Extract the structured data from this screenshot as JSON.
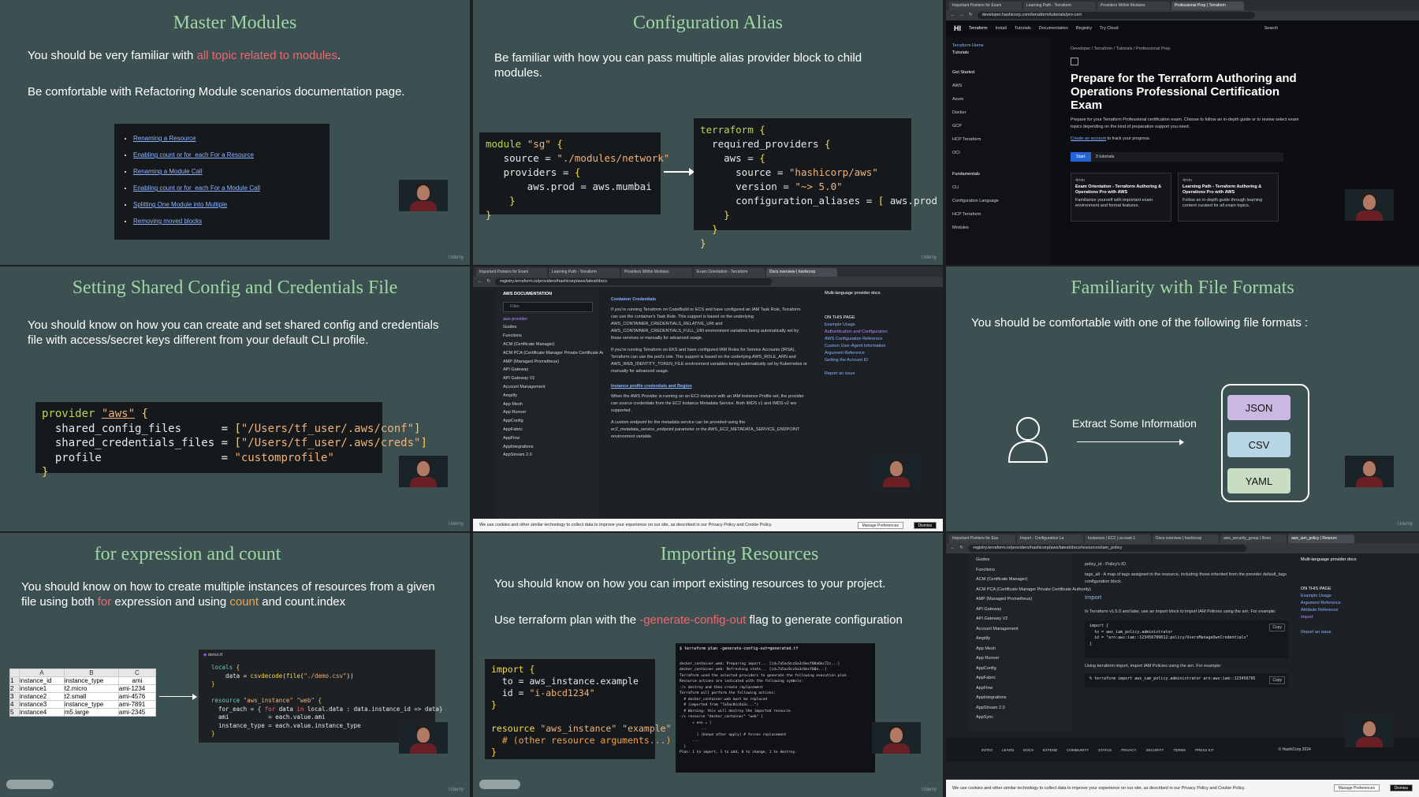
{
  "tiles": {
    "master_modules": {
      "title": "Master Modules",
      "p1_prefix": "You should be very familiar with ",
      "p1_highlight": "all topic related to modules",
      "p1_suffix": ".",
      "p2": "Be comfortable with Refactoring Module scenarios documentation page.",
      "links": [
        "Renaming a Resource",
        "Enabling count or for_each For a Resource",
        "Renaming a Module Call",
        "Enabling count or for_each For a Module Call",
        "Splitting One Module into Multiple",
        "Removing moved blocks"
      ]
    },
    "config_alias": {
      "title": "Configuration Alias",
      "p1": "Be familiar with how you can pass multiple alias provider block to child modules."
    },
    "terraform_page": {
      "tabs": [
        "Important Pointers for Exam",
        "Learning Path - Terraform",
        "Providers Within Modules",
        "Professional Prep | Terraform"
      ],
      "url": "developer.hashicorp.com/terraform/tutorials/pro-cert",
      "nav": [
        "Terraform",
        "Install",
        "Tutorials",
        "Documentation",
        "Registry",
        "Try Cloud"
      ],
      "search": "Search",
      "side_back": "Terraform Home",
      "side_tutorials": "Tutorials",
      "side_items": [
        "Get Started",
        "AWS",
        "Azure",
        "Docker",
        "GCP",
        "HCP Terraform",
        "OCI"
      ],
      "side_section": "Fundamentals",
      "side_items2": [
        "CLI",
        "Configuration Language",
        "HCP Terraform",
        "Modules"
      ],
      "breadcrumb": "Developer  /  Terraform  /  Tutorials  /  Professional Prep",
      "heading": "Prepare for the Terraform Authoring and Operations Professional Certification Exam",
      "desc": "Prepare for your Terraform Professional certification exam. Choose to follow an in-depth guide or to review select exam topics depending on the kind of preparation support you need.",
      "signin": "Create an account",
      "signin_suffix": " to track your progress.",
      "start": "Start",
      "count": "3 tutorials",
      "card1_time": "4min",
      "card1_title": "Exam Orientation - Terraform Authoring & Operations Pro with AWS",
      "card1_desc": "Familiarize yourself with important exam environment and format features.",
      "card2_time": "4min",
      "card2_title": "Learning Path - Terraform Authoring & Operations Pro with AWS",
      "card2_desc": "Follow an in-depth guide through learning content curated for all exam topics."
    },
    "shared_config": {
      "title": "Setting Shared Config and Credentials File",
      "p1": "You should know on how you can create and set shared config and credentials file with access/secret keys different from your default CLI profile."
    },
    "aws_docs": {
      "tabs": [
        "Important Pointers for Exam",
        "Learning Path - Terraform",
        "Providers Within Modules",
        "Exam Orientation - Terraform",
        "Docs overview | hashicorp"
      ],
      "url": "registry.terraform.io/providers/hashicorp/aws/latest/docs",
      "side_title": "AWS DOCUMENTATION",
      "filter": "Filter",
      "side_items": [
        "aws provider",
        "Guides",
        "Functions",
        "ACM (Certificate Manager)",
        "ACM PCA (Certificate Manager Private Certificate Authority)",
        "AMP (Managed Prometheus)",
        "API Gateway",
        "API Gateway V2",
        "Account Management",
        "Amplify",
        "App Mesh",
        "App Runner",
        "AppConfig",
        "AppFabric",
        "AppFlow",
        "AppIntegrations",
        "AppStream 2.0"
      ],
      "h1": "Container Credentials",
      "t1": "If you're running Terraform on CodeBuild or ECS and have configured an IAM Task Role, Terraform can use the container's Task Role. This support is based on the underlying AWS_CONTAINER_CREDENTIALS_RELATIVE_URI and AWS_CONTAINER_CREDENTIALS_FULL_URI environment variables being automatically set by those services or manually for advanced usage.",
      "t2": "If you're running Terraform on EKS and have configured IAM Roles for Service Accounts (IRSA), Terraform can use the pod's role. This support is based on the underlying AWS_ROLE_ARN and AWS_WEB_IDENTITY_TOKEN_FILE environment variables being automatically set by Kubernetes or manually for advanced usage.",
      "h2": "Instance profile credentials and Region",
      "t3": "When the AWS Provider is running on an EC2 instance with an IAM Instance Profile set, the provider can source credentials from the EC2 Instance Metadata Service. Both IMDS v1 and IMDS v2 are supported.",
      "t4": "A custom endpoint for the metadata service can be provided using the ec2_metadata_service_endpoint parameter or the AWS_EC2_METADATA_SERVICE_ENDPOINT environment variable.",
      "right_title": "Multi-language provider docs",
      "right_items": [
        "ON THIS PAGE",
        "Example Usage",
        "Authentication and Configuration",
        "AWS Configuration Reference",
        "Custom User-Agent Information",
        "Argument Reference",
        "Getting the Account ID"
      ],
      "report": "Report an issue",
      "cookie": "We use cookies and other similar technology to collect data to improve your experience on our site, as described in our Privacy Policy and Cookie Policy.",
      "manage": "Manage Preferences",
      "dismiss": "Dismiss"
    },
    "file_formats": {
      "title": "Familiarity with  File Formats",
      "p1": "You should be comfortable with one of the following file formats :",
      "extract": "Extract Some Information",
      "formats": [
        "JSON",
        "CSV",
        "YAML"
      ]
    },
    "for_count": {
      "title": "for expression and count",
      "p1_a": "You should know on how to create multiple instances of resources from a given file using both ",
      "p1_for": "for",
      "p1_b": " expression and using ",
      "p1_count": "count",
      "p1_c": " and count.index",
      "sheet_cols": [
        "",
        "A",
        "B",
        "C"
      ],
      "sheet_rows": [
        [
          "1",
          "instance_id",
          "instance_type",
          "ami"
        ],
        [
          "2",
          "instance1",
          "t2.micro",
          "ami-1234"
        ],
        [
          "3",
          "instance2",
          "t2.small",
          "ami-4576"
        ],
        [
          "4",
          "instance3",
          "instance_type",
          "ami-7891"
        ],
        [
          "5",
          "instance4",
          "m5.large",
          "ami-2345"
        ]
      ],
      "file_tab": "demo.tf"
    },
    "importing": {
      "title": "Importing Resources",
      "p1": "You should know on how you can import existing resources to your project.",
      "p2_a": "Use terraform plan with the ",
      "p2_flag": "-generate-config-out",
      "p2_b": " flag to generate configuration",
      "terminal_title": "$ terraform plan -generate-config-out=generated.tf",
      "terminal_lines": [
        "docker_container.web: Preparing import... [id=7a5ac8cc6a3c8ecf00a6bc72c...]",
        "docker_container.web: Refreshing state... [id=7a5ac8cc6a3c8ecf00a...]",
        "Terraform used the selected providers to generate the following execution plan.",
        "Resource actions are indicated with the following symbols:",
        "-/+ destroy and then create replacement",
        "",
        "Terraform will perform the following actions:",
        "",
        "  # docker_container.web must be replaced",
        "  # (imported from \"7a5ac8cc6a3c...\")",
        "  # Warning: this will destroy the imported resource",
        "-/+ resource \"docker_container\" \"web\" {",
        "      + env = [",
        "          ...",
        "        ] (known after apply) # forces replacement",
        "      ...",
        "  }",
        "",
        "Plan: 1 to import, 1 to add, 0 to change, 1 to destroy."
      ]
    },
    "iam_docs": {
      "tabs": [
        "Important Pointers for Exa",
        "Import - Configuration La",
        "Instances | EC2 | us-east-1",
        "Docs overview | hashicorp",
        "aws_security_group | Reso",
        "aws_iam_policy | Resourc"
      ],
      "url": "registry.terraform.io/providers/hashicorp/aws/latest/docs/resources/iam_policy",
      "side_items": [
        "Guides",
        "Functions",
        "ACM (Certificate Manager)",
        "ACM PCA (Certificate Manager Private Certificate Authority)",
        "AMP (Managed Prometheus)",
        "API Gateway",
        "API Gateway V2",
        "Account Management",
        "Amplify",
        "App Mesh",
        "App Runner",
        "AppConfig",
        "AppFabric",
        "AppFlow",
        "AppIntegrations",
        "AppStream 2.0",
        "AppSync"
      ],
      "attr1": "policy_id - Policy's ID.",
      "attr2": "tags_all - A map of tags assigned to the resource, including those inherited from the provider default_tags configuration block.",
      "import_h": "Import",
      "import_t": "In Terraform v1.5.0 and later, use an import block to import IAM Policies using the arn. For example:",
      "code1": "import {\n  to = aws_iam_policy.administrator\n  id = \"arn:aws:iam::123456789012:policy/UsersManageOwnCredentials\"\n}",
      "using": "Using terraform import, import IAM Policies using the arn. For example:",
      "code2": "% terraform import aws_iam_policy.administrator arn:aws:iam::123456789012:p",
      "copy": "Copy",
      "right_title": "Multi-language provider docs",
      "right_items": [
        "ON THIS PAGE",
        "Example Usage",
        "Argument Reference",
        "Attribute Reference",
        "Import"
      ],
      "report": "Report an issue",
      "footer": [
        "INTRO",
        "LEARN",
        "DOCS",
        "EXTEND",
        "COMMUNITY",
        "STATUS",
        "PRIVACY",
        "SECURITY",
        "TERMS",
        "PRESS KIT"
      ],
      "brand": "© HashiCorp 2024",
      "cookie": "We use cookies and other similar technology to collect data to improve your experience on our site, as described in our Privacy Policy and Cookie Policy.",
      "manage": "Manage Preferences",
      "dismiss": "Dismiss"
    }
  },
  "watermark": "Udemy"
}
